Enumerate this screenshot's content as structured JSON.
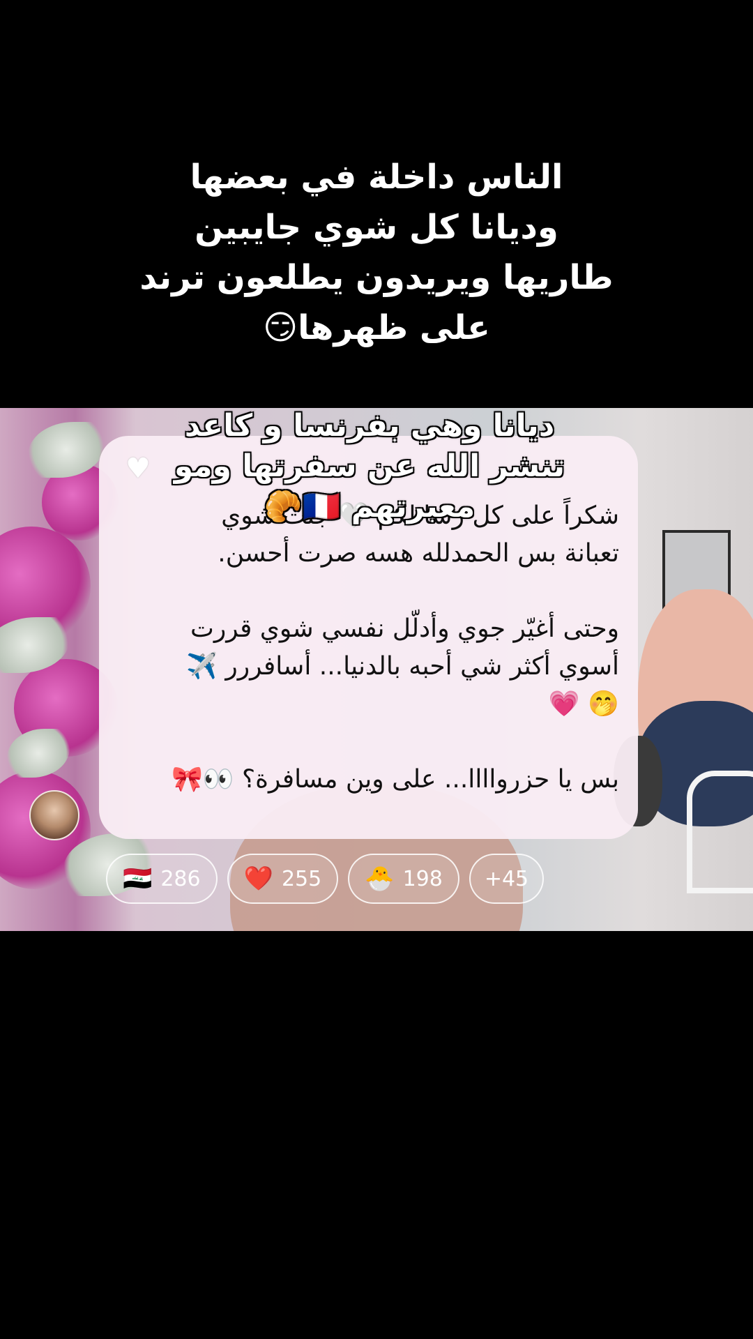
{
  "caption": {
    "line1": "الناس داخلة في بعضها",
    "line2": "وديانا كل شوي جايبين",
    "line3": "طاريها ويريدون يطلعون ترند",
    "line4": "على ظهرها😏"
  },
  "overlay_caption": {
    "line1": "ديانا وهي بفرنسا و كاعد",
    "line2": "تنشر الله عن سفرتها ومو",
    "line3": "معبرتهم 🇫🇷🥐"
  },
  "message": {
    "heart_icon": "white-heart-icon",
    "paragraph1": "شكراً على كل رسائلكم 🤍 جنت شوي\nتعبانة بس الحمدلله هسه صرت أحسن.",
    "paragraph2": "وحتى أغيّر جوي وأدلّل نفسي شوي قررت\nأسوي أكثر شي أحبه بالدنيا... أسافررر ✈️\n🤭 💗",
    "paragraph3": "بس يا حزرواااا... على وين مسافرة؟ 👀🎀"
  },
  "reactions": [
    {
      "icon": "🇮🇶",
      "icon_name": "iraq-flag-icon",
      "count": "286"
    },
    {
      "icon": "❤️",
      "icon_name": "red-heart-icon",
      "count": "255"
    },
    {
      "icon": "🐣",
      "icon_name": "hatching-chick-icon",
      "count": "198"
    },
    {
      "label": "+45"
    }
  ],
  "colors": {
    "background": "#000000",
    "card": "#f9ecf4",
    "caption_text": "#ffffff"
  }
}
